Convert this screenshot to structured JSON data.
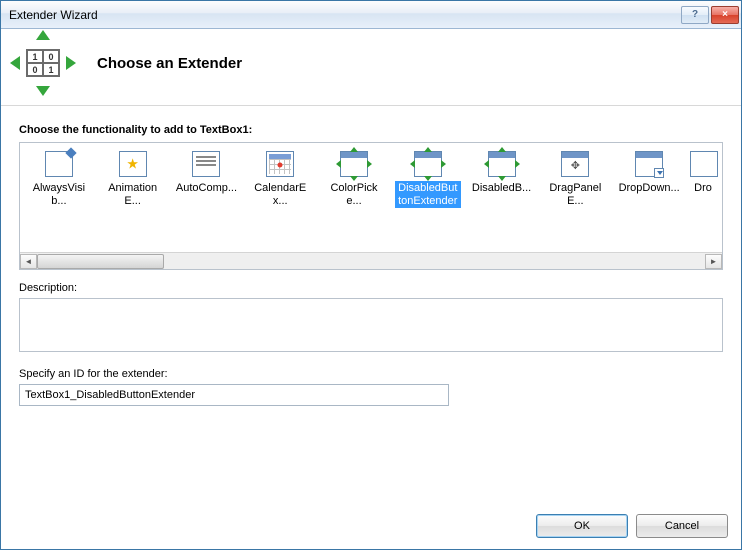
{
  "window": {
    "title": "Extender Wizard",
    "help_tooltip": "?",
    "close_tooltip": "×"
  },
  "header": {
    "title": "Choose an Extender"
  },
  "functionality_label": "Choose the functionality to add to TextBox1:",
  "extenders": [
    {
      "label": "AlwaysVisib...",
      "icon": "pin",
      "selected": false
    },
    {
      "label": "AnimationE...",
      "icon": "star",
      "selected": false
    },
    {
      "label": "AutoComp...",
      "icon": "lines",
      "selected": false
    },
    {
      "label": "CalendarEx...",
      "icon": "calendar",
      "selected": false
    },
    {
      "label": "ColorPicke...",
      "icon": "arrows",
      "selected": false
    },
    {
      "label": "DisabledButtonExtender",
      "icon": "arrows-blue",
      "selected": true
    },
    {
      "label": "DisabledB...",
      "icon": "arrows",
      "selected": false
    },
    {
      "label": "DragPanelE...",
      "icon": "move",
      "selected": false
    },
    {
      "label": "DropDown...",
      "icon": "dropdown",
      "selected": false
    },
    {
      "label": "Dro",
      "icon": "none",
      "selected": false,
      "narrow": true
    }
  ],
  "description_label": "Description:",
  "description_text": "",
  "id_label": "Specify an ID for the extender:",
  "id_value": "TextBox1_DisabledButtonExtender",
  "buttons": {
    "ok": "OK",
    "cancel": "Cancel"
  }
}
